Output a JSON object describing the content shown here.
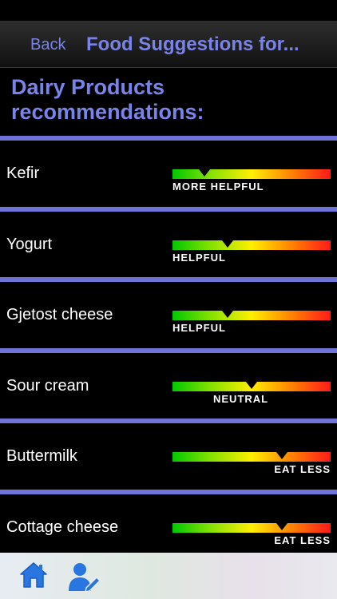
{
  "nav": {
    "back_label": "Back",
    "title": "Food Suggestions for..."
  },
  "section": {
    "title": "Dairy Products recommendations:"
  },
  "colors": {
    "accent": "#7a84e8",
    "divider": "#6f73d8",
    "gauge_good": "#00c800",
    "gauge_neutral": "#ffee00",
    "gauge_bad": "#ff1a1a"
  },
  "foods": [
    {
      "name": "Kefir",
      "rating": "MORE HELPFUL",
      "level": 0.2
    },
    {
      "name": "Yogurt",
      "rating": "HELPFUL",
      "level": 0.35
    },
    {
      "name": "Gjetost cheese",
      "rating": "HELPFUL",
      "level": 0.35
    },
    {
      "name": "Sour cream",
      "rating": "NEUTRAL",
      "level": 0.5
    },
    {
      "name": "Buttermilk",
      "rating": "EAT LESS",
      "level": 0.69
    },
    {
      "name": "Cottage cheese",
      "rating": "EAT LESS",
      "level": 0.69
    }
  ],
  "tabbar": {
    "icons": [
      "home-icon",
      "user-edit-icon"
    ]
  }
}
